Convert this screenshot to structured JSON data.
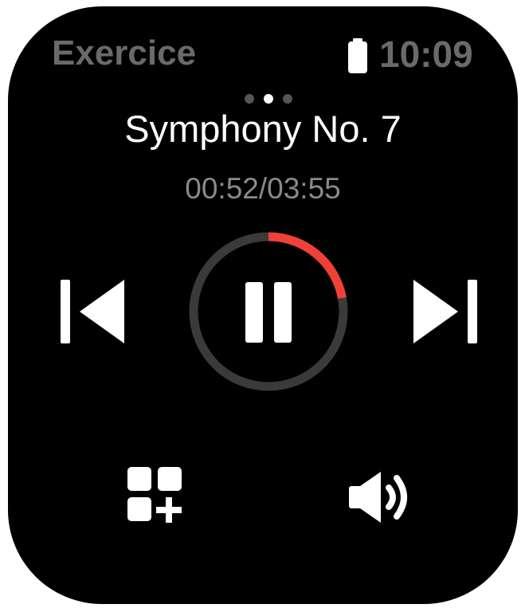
{
  "status_bar": {
    "app_name": "Exercice",
    "time": "10:09",
    "battery_icon": "battery-full-icon"
  },
  "pager": {
    "count": 3,
    "active_index": 1
  },
  "player": {
    "title": "Symphony No. 7",
    "elapsed_total": "00:52/03:55",
    "progress_fraction": 0.221,
    "state": "playing"
  },
  "controls": {
    "previous_icon": "skip-previous-icon",
    "pause_icon": "pause-icon",
    "next_icon": "skip-next-icon",
    "apps_icon": "add-to-playlist-icon",
    "volume_icon": "volume-icon"
  },
  "colors": {
    "background": "#000000",
    "progress": "#f04038",
    "track": "#3a3a3a",
    "text_primary": "#ffffff",
    "text_dim": "#6a6a6a"
  }
}
